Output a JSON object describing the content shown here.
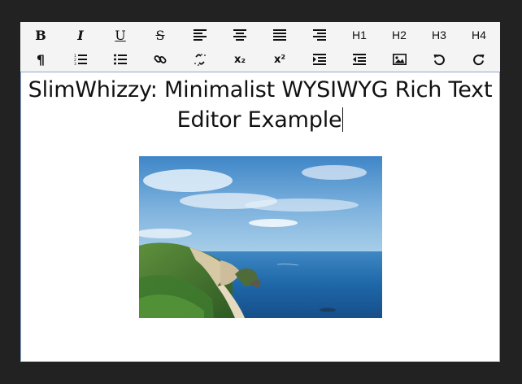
{
  "toolbar": {
    "row1": [
      {
        "name": "bold-button",
        "label": "B",
        "icon": "bold"
      },
      {
        "name": "italic-button",
        "label": "I",
        "icon": "italic"
      },
      {
        "name": "underline-button",
        "label": "U",
        "icon": "underline"
      },
      {
        "name": "strikethrough-button",
        "label": "S",
        "icon": "strikethrough"
      },
      {
        "name": "align-left-button",
        "label": "",
        "icon": "align-left-icon"
      },
      {
        "name": "align-center-button",
        "label": "",
        "icon": "align-center-icon"
      },
      {
        "name": "align-justify-button",
        "label": "",
        "icon": "align-justify-icon"
      },
      {
        "name": "align-right-button",
        "label": "",
        "icon": "align-right-icon"
      },
      {
        "name": "heading-1-button",
        "label": "H1",
        "icon": "heading"
      },
      {
        "name": "heading-2-button",
        "label": "H2",
        "icon": "heading"
      },
      {
        "name": "heading-3-button",
        "label": "H3",
        "icon": "heading"
      },
      {
        "name": "heading-4-button",
        "label": "H4",
        "icon": "heading"
      }
    ],
    "row2": [
      {
        "name": "paragraph-button",
        "label": "¶",
        "icon": "pilcrow-icon"
      },
      {
        "name": "ordered-list-button",
        "label": "",
        "icon": "ordered-list-icon"
      },
      {
        "name": "unordered-list-button",
        "label": "",
        "icon": "bullet-list-icon"
      },
      {
        "name": "link-button",
        "label": "",
        "icon": "link-icon"
      },
      {
        "name": "unlink-button",
        "label": "",
        "icon": "unlink-icon"
      },
      {
        "name": "subscript-button",
        "label": "x₂",
        "icon": "subscript"
      },
      {
        "name": "superscript-button",
        "label": "x²",
        "icon": "superscript"
      },
      {
        "name": "indent-button",
        "label": "",
        "icon": "indent-icon"
      },
      {
        "name": "outdent-button",
        "label": "",
        "icon": "outdent-icon"
      },
      {
        "name": "insert-image-button",
        "label": "",
        "icon": "image-icon"
      },
      {
        "name": "undo-button",
        "label": "",
        "icon": "undo-icon"
      },
      {
        "name": "redo-button",
        "label": "",
        "icon": "redo-icon"
      }
    ]
  },
  "content": {
    "title": "SlimWhizzy: Minimalist WYSIWYG Rich Text Editor Example",
    "image_description": "coastal-landscape-photo"
  },
  "colors": {
    "page_background": "#222222",
    "toolbar_background": "#f4f4f4",
    "editor_border": "#8aa6cf",
    "text": "#111111"
  }
}
